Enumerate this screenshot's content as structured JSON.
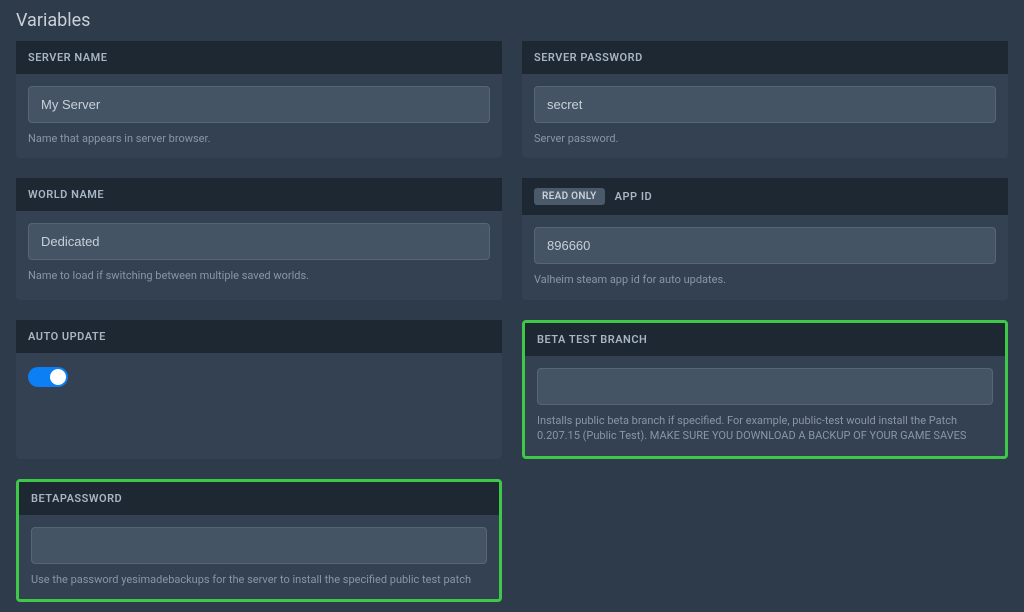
{
  "pageTitle": "Variables",
  "variables": {
    "serverName": {
      "label": "SERVER NAME",
      "value": "My Server",
      "description": "Name that appears in server browser."
    },
    "serverPassword": {
      "label": "SERVER PASSWORD",
      "value": "secret",
      "description": "Server password."
    },
    "worldName": {
      "label": "WORLD NAME",
      "value": "Dedicated",
      "description": "Name to load if switching between multiple saved worlds."
    },
    "appId": {
      "readOnlyBadge": "READ ONLY",
      "label": "APP ID",
      "value": "896660",
      "description": "Valheim steam app id for auto updates."
    },
    "autoUpdate": {
      "label": "AUTO UPDATE",
      "value": true
    },
    "betaTestBranch": {
      "label": "BETA TEST BRANCH",
      "value": "",
      "description": "Installs public beta branch if specified. For example, public-test would install the Patch 0.207.15 (Public Test). MAKE SURE YOU DOWNLOAD A BACKUP OF YOUR GAME SAVES"
    },
    "betaPassword": {
      "label": "BETAPASSWORD",
      "value": "",
      "description": "Use the password yesimadebackups for the server to install the specified public test patch"
    }
  }
}
